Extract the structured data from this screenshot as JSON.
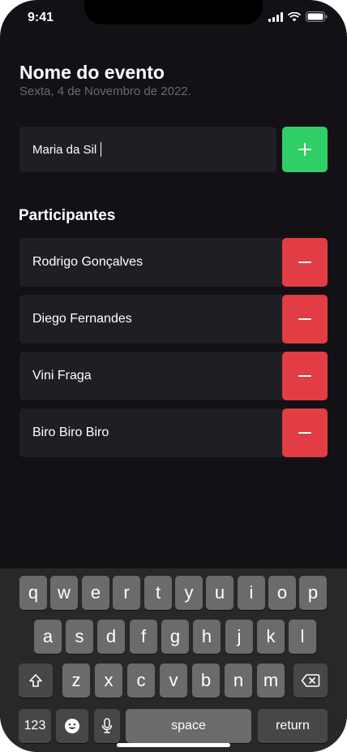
{
  "status_bar": {
    "time": "9:41"
  },
  "event": {
    "title": "Nome do evento",
    "date": "Sexta, 4 de Novembro de 2022."
  },
  "input": {
    "value": "Maria da Sil",
    "add_label": "+"
  },
  "participants": {
    "heading": "Participantes",
    "items": [
      {
        "name": "Rodrigo Gonçalves"
      },
      {
        "name": "Diego Fernandes"
      },
      {
        "name": "Vini Fraga"
      },
      {
        "name": "Biro Biro Biro"
      }
    ],
    "remove_label": "−"
  },
  "keyboard": {
    "row1": [
      "q",
      "w",
      "e",
      "r",
      "t",
      "y",
      "u",
      "i",
      "o",
      "p"
    ],
    "row2": [
      "a",
      "s",
      "d",
      "f",
      "g",
      "h",
      "j",
      "k",
      "l"
    ],
    "row3": [
      "z",
      "x",
      "c",
      "v",
      "b",
      "n",
      "m"
    ],
    "numbers_label": "123",
    "space_label": "space",
    "return_label": "return",
    "icons": [
      "shift-icon",
      "backspace-icon",
      "emoji-icon",
      "microphone-icon"
    ]
  },
  "colors": {
    "background": "#131016",
    "input_bg": "#1f1e25",
    "add": "#31cf67",
    "remove": "#e23c44"
  }
}
